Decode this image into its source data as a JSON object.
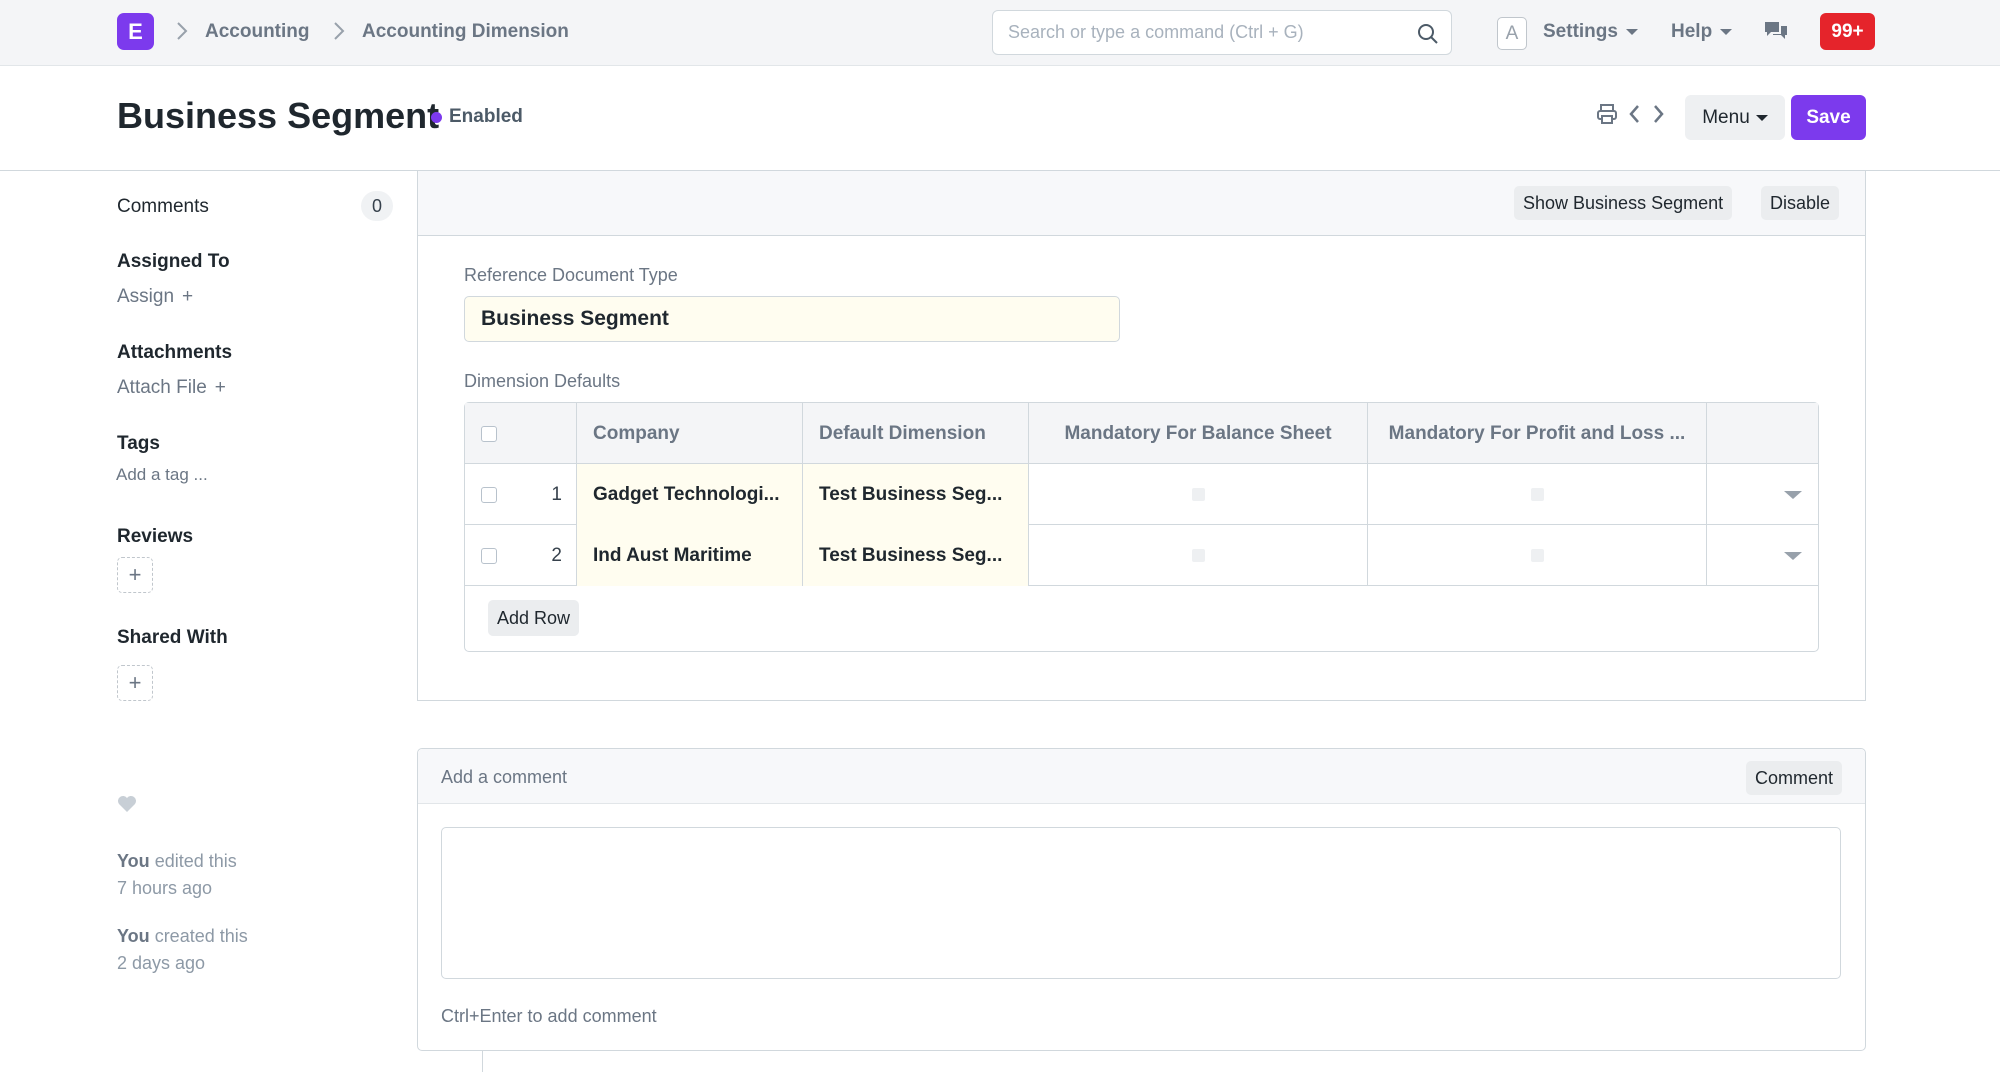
{
  "navbar": {
    "logo_letter": "E",
    "breadcrumbs": [
      "Accounting",
      "Accounting Dimension"
    ],
    "search_placeholder": "Search or type a command (Ctrl + G)",
    "avatar_letter": "A",
    "settings_label": "Settings",
    "help_label": "Help",
    "notification_count": "99+"
  },
  "page": {
    "title": "Business Segment",
    "status": "Enabled",
    "menu_label": "Menu",
    "save_label": "Save",
    "accent_color": "#7c3aed"
  },
  "sidebar": {
    "comments_label": "Comments",
    "comments_count": "0",
    "assigned_to_label": "Assigned To",
    "assign_label": "Assign",
    "attachments_label": "Attachments",
    "attach_file_label": "Attach File",
    "tags_label": "Tags",
    "add_tag_label": "Add a tag ...",
    "reviews_label": "Reviews",
    "shared_with_label": "Shared With",
    "activity": [
      {
        "who": "You",
        "action": "edited this",
        "when": "7 hours ago"
      },
      {
        "who": "You",
        "action": "created this",
        "when": "2 days ago"
      }
    ]
  },
  "form": {
    "toolbar": {
      "show_label": "Show Business Segment",
      "disable_label": "Disable"
    },
    "reference_label": "Reference Document Type",
    "reference_value": "Business Segment",
    "defaults_label": "Dimension Defaults",
    "grid": {
      "columns": [
        "Company",
        "Default Dimension",
        "Mandatory For Balance Sheet",
        "Mandatory For Profit and Loss ..."
      ],
      "rows": [
        {
          "idx": "1",
          "company": "Gadget Technologi...",
          "dimension": "Test Business Seg..."
        },
        {
          "idx": "2",
          "company": "Ind Aust Maritime",
          "dimension": "Test Business Seg..."
        }
      ],
      "add_row_label": "Add Row"
    }
  },
  "comment": {
    "header_label": "Add a comment",
    "button_label": "Comment",
    "hint": "Ctrl+Enter to add comment"
  }
}
